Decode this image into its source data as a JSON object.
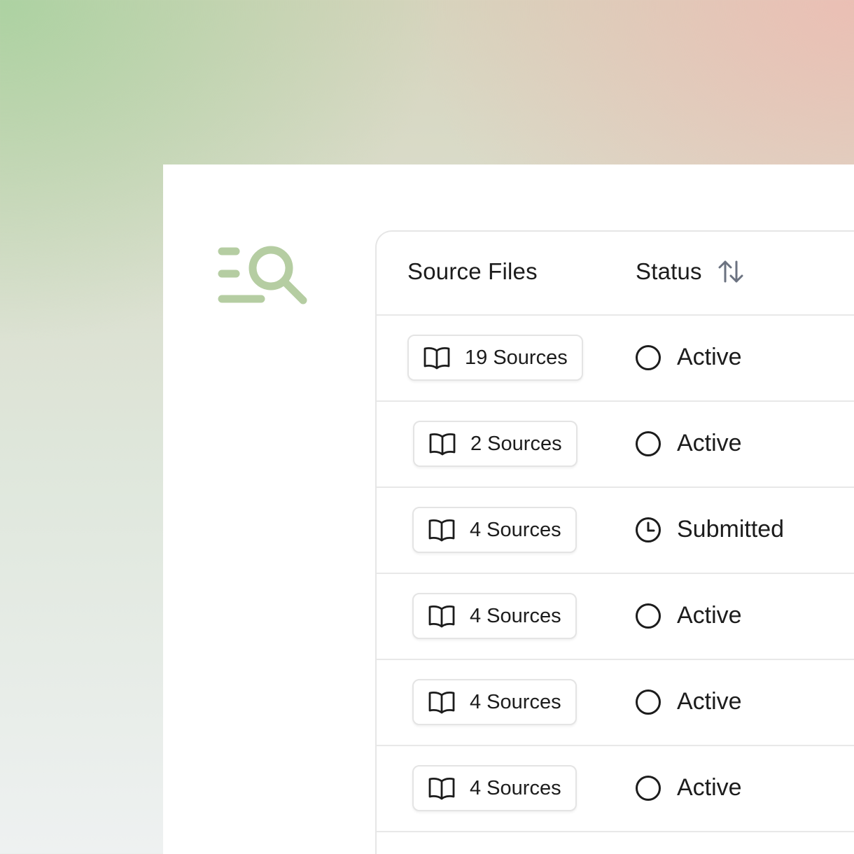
{
  "colors": {
    "logo": "#b5cda2",
    "text": "#1c1c1c",
    "border": "#e6e6e6",
    "sort_icon": "#6b7280"
  },
  "logo": {
    "icon": "search-list-icon"
  },
  "table": {
    "headers": {
      "source_files": "Source Files",
      "status": "Status",
      "sort_icon": "sort-arrows-icon"
    },
    "rows": [
      {
        "sources": "19 Sources",
        "status": "Active",
        "status_icon": "circle-icon"
      },
      {
        "sources": "2 Sources",
        "status": "Active",
        "status_icon": "circle-icon"
      },
      {
        "sources": "4 Sources",
        "status": "Submitted",
        "status_icon": "clock-icon"
      },
      {
        "sources": "4 Sources",
        "status": "Active",
        "status_icon": "circle-icon"
      },
      {
        "sources": "4 Sources",
        "status": "Active",
        "status_icon": "circle-icon"
      },
      {
        "sources": "4 Sources",
        "status": "Active",
        "status_icon": "circle-icon"
      }
    ]
  }
}
